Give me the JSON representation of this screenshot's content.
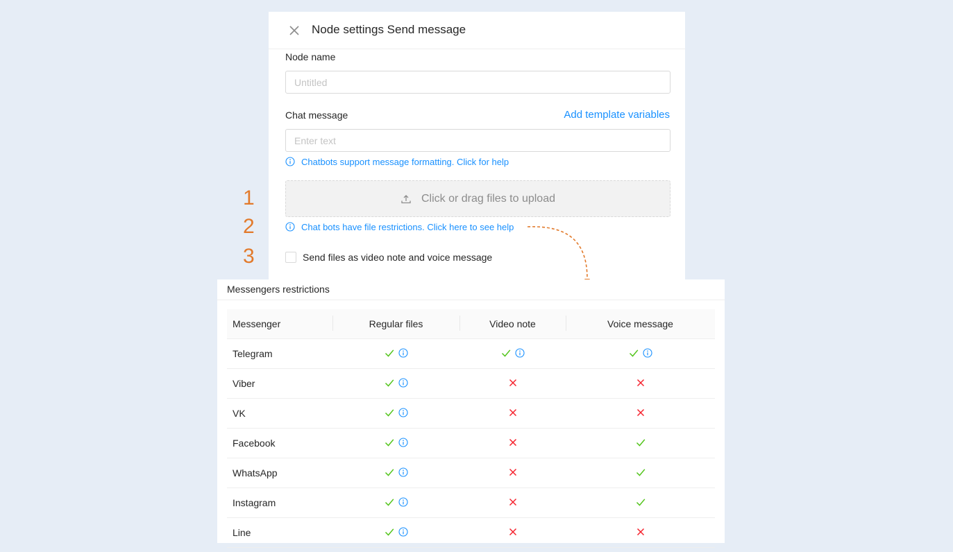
{
  "panel": {
    "title": "Node settings Send message",
    "node_name_label": "Node name",
    "node_name_placeholder": "Untitled",
    "chat_message_label": "Chat message",
    "add_template_variables": "Add template variables",
    "chat_message_placeholder": "Enter text",
    "formatting_help": "Chatbots support message formatting. Click for help",
    "upload_text": "Click or drag files to upload",
    "file_restrictions_help": "Chat bots have file restrictions. Click here to see help",
    "send_files_checkbox": "Send files as video note and voice message"
  },
  "annotations": {
    "step_numbers": [
      "1",
      "2",
      "3"
    ],
    "accent_color": "#e27a2b"
  },
  "restrictions": {
    "title": "Messengers restrictions",
    "columns": [
      "Messenger",
      "Regular files",
      "Video note",
      "Voice message"
    ],
    "rows": [
      {
        "messenger": "Telegram",
        "regular": true,
        "regular_info": true,
        "video": true,
        "video_info": true,
        "voice": true,
        "voice_info": true
      },
      {
        "messenger": "Viber",
        "regular": true,
        "regular_info": true,
        "video": false,
        "video_info": false,
        "voice": false,
        "voice_info": false
      },
      {
        "messenger": "VK",
        "regular": true,
        "regular_info": true,
        "video": false,
        "video_info": false,
        "voice": false,
        "voice_info": false
      },
      {
        "messenger": "Facebook",
        "regular": true,
        "regular_info": true,
        "video": false,
        "video_info": false,
        "voice": true,
        "voice_info": false
      },
      {
        "messenger": "WhatsApp",
        "regular": true,
        "regular_info": true,
        "video": false,
        "video_info": false,
        "voice": true,
        "voice_info": false
      },
      {
        "messenger": "Instagram",
        "regular": true,
        "regular_info": true,
        "video": false,
        "video_info": false,
        "voice": true,
        "voice_info": false
      },
      {
        "messenger": "Line",
        "regular": true,
        "regular_info": true,
        "video": false,
        "video_info": false,
        "voice": false,
        "voice_info": false
      }
    ]
  },
  "colors": {
    "link_blue": "#1890ff",
    "check_green": "#52c41a",
    "cross_red": "#f5222d",
    "background": "#e6edf6"
  },
  "icons": {
    "close": "close-icon",
    "info": "info-icon",
    "upload": "upload-icon",
    "check": "check-icon",
    "cross": "cross-icon"
  }
}
